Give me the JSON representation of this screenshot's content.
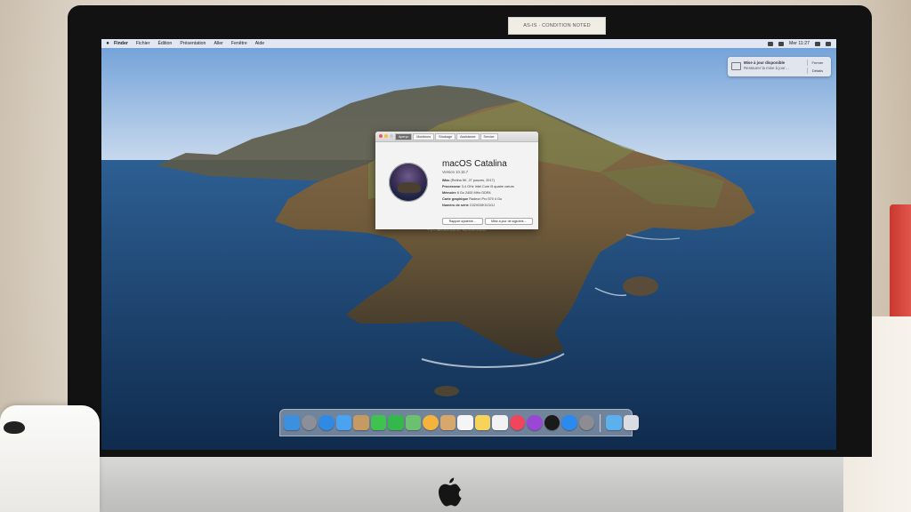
{
  "sticker": {
    "text": "AS-IS · CONDITION NOTED"
  },
  "menubar": {
    "app_name": "Finder",
    "items": [
      "Fichier",
      "Édition",
      "Présentation",
      "Aller",
      "Fenêtre",
      "Aide"
    ],
    "clock": "Mer 11:27"
  },
  "notification": {
    "title": "Mise à jour disponible",
    "body": "Restaurer la mise à jour…",
    "button_top": "Fermer",
    "button_bottom": "Détails"
  },
  "about_window": {
    "tabs": [
      "Aperçu",
      "Moniteurs",
      "Stockage",
      "Assistance",
      "Service"
    ],
    "os_name": "macOS Catalina",
    "os_version": "Version 10.15.7",
    "specs": [
      {
        "label": "iMac",
        "value": "(Retina 5K, 27 pouces, 2017)"
      },
      {
        "label": "Processeur",
        "value": "3,4 GHz Intel Core i5 quatre cœurs"
      },
      {
        "label": "Mémoire",
        "value": "8 Go 2400 MHz DDR4"
      },
      {
        "label": "Carte graphique",
        "value": "Radeon Pro 570 4 Go"
      },
      {
        "label": "Numéro de série",
        "value": "C02VD0KXJ1GJ"
      }
    ],
    "button_report": "Rapport système…",
    "button_update": "Mise à jour de logiciels…",
    "copyright": "™ et © 1983-2020 Apple Inc. Tous droits réservés."
  },
  "dock": {
    "apps": [
      {
        "name": "finder-icon",
        "color": "#3d8fe0"
      },
      {
        "name": "launchpad-icon",
        "color": "#8a8f99"
      },
      {
        "name": "safari-icon",
        "color": "#2f8ae6"
      },
      {
        "name": "mail-icon",
        "color": "#4aa3f0"
      },
      {
        "name": "contacts-icon",
        "color": "#c79a63"
      },
      {
        "name": "messages-icon",
        "color": "#3fc24f"
      },
      {
        "name": "facetime-icon",
        "color": "#34b84b"
      },
      {
        "name": "maps-icon",
        "color": "#6cc070"
      },
      {
        "name": "photos-icon",
        "color": "#f4b33a"
      },
      {
        "name": "contacts-book-icon",
        "color": "#d7a76c"
      },
      {
        "name": "calendar-icon",
        "color": "#f5f5f5"
      },
      {
        "name": "notes-icon",
        "color": "#f7d35a"
      },
      {
        "name": "reminders-icon",
        "color": "#f2f2f2"
      },
      {
        "name": "music-icon",
        "color": "#f0455c"
      },
      {
        "name": "podcasts-icon",
        "color": "#9b47d6"
      },
      {
        "name": "apple-tv-icon",
        "color": "#1a1a1a"
      },
      {
        "name": "app-store-icon",
        "color": "#2a8af0"
      },
      {
        "name": "system-preferences-icon",
        "color": "#8c8c92"
      }
    ],
    "trailing": [
      {
        "name": "downloads-folder-icon",
        "color": "#5cb0ee"
      },
      {
        "name": "trash-icon",
        "color": "#d9dde2"
      }
    ]
  }
}
